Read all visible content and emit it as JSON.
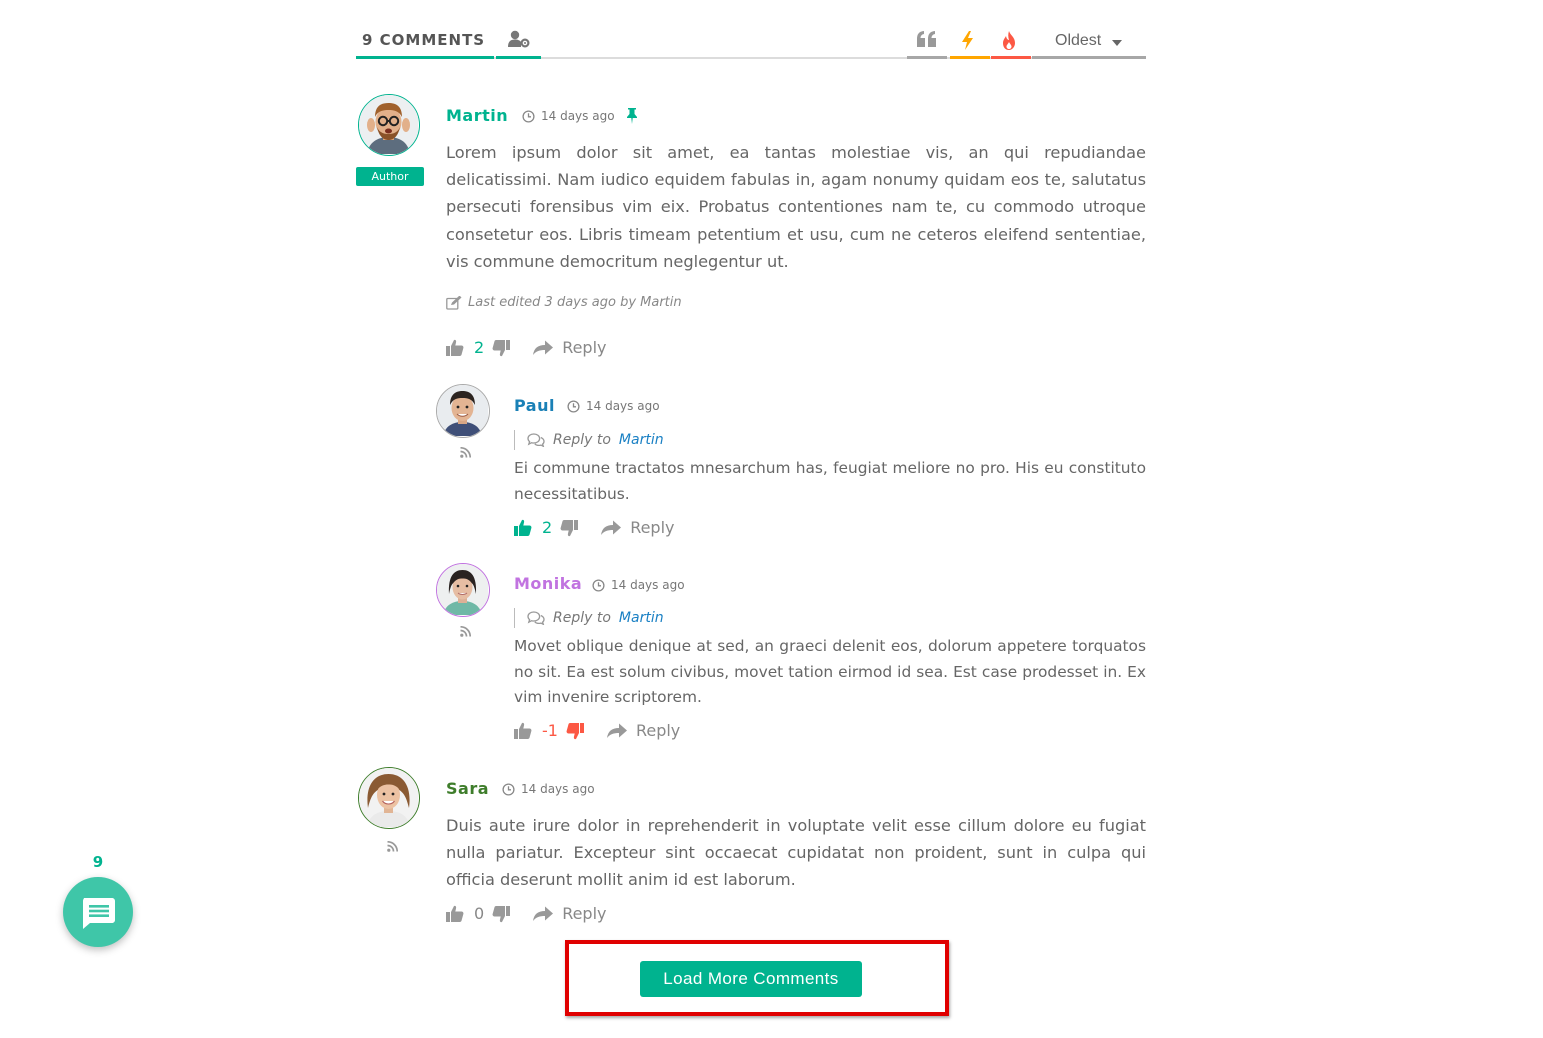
{
  "header": {
    "comment_count_label": "9 COMMENTS",
    "sort_order": "Oldest",
    "accent_color": "#00b38f"
  },
  "comments": [
    {
      "author": "Martin",
      "author_color": "#00b38f",
      "badge": "Author",
      "time": "14 days ago",
      "pinned": true,
      "text": "Lorem ipsum dolor sit amet, ea tantas molestiae vis, an qui repudiandae delicatissimi. Nam iudico equidem fabulas in, agam nonumy quidam eos te, salutatus persecuti forensibus vim eix. Probatus contentiones nam te, cu commodo utroque consetetur eos. Libris timeam petentium et usu, cum ne ceteros eleifend sententiae, vis commune democritum neglegentur ut.",
      "edited": "Last edited 3 days ago by Martin",
      "votes": "2",
      "reply_label": "Reply"
    },
    {
      "author": "Paul",
      "author_color": "#1a80b6",
      "time": "14 days ago",
      "reply_to_label": "Reply to",
      "reply_to": "Martin",
      "text": "Ei commune tractatos mnesarchum has, feugiat meliore no pro. His eu constituto necessitatibus.",
      "votes": "2",
      "reply_label": "Reply"
    },
    {
      "author": "Monika",
      "author_color": "#c173e0",
      "time": "14 days ago",
      "reply_to_label": "Reply to",
      "reply_to": "Martin",
      "text": "Movet oblique denique at sed, an graeci delenit eos, dolorum appetere torquatos no sit. Ea est solum civibus, movet tation eirmod id sea. Est case prodesset in. Ex vim invenire scriptorem.",
      "votes": "-1",
      "reply_label": "Reply"
    },
    {
      "author": "Sara",
      "author_color": "#3e7d2b",
      "time": "14 days ago",
      "text": "Duis aute irure dolor in reprehenderit in voluptate velit esse cillum dolore eu fugiat nulla pariatur. Excepteur sint occaecat cupidatat non proident, sunt in culpa qui officia deserunt mollit anim id est laborum.",
      "votes": "0",
      "reply_label": "Reply"
    }
  ],
  "load_more_label": "Load More Comments",
  "bubble": {
    "count": "9",
    "icon": "comment-bubble-icon"
  }
}
